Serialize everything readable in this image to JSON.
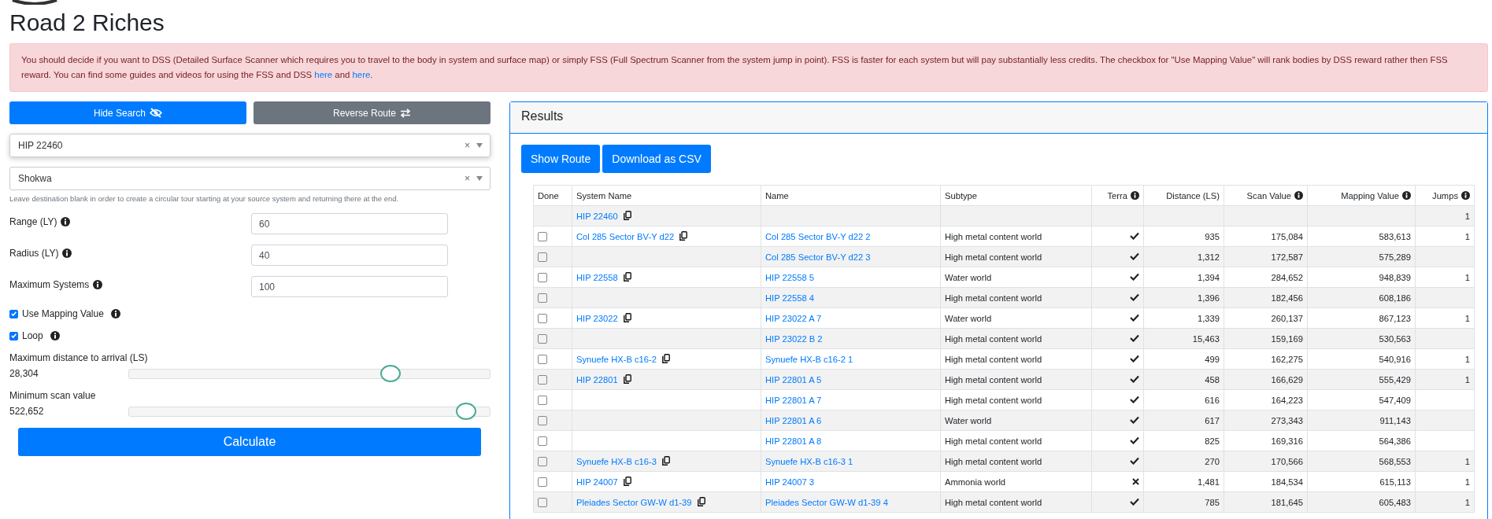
{
  "title": "Road 2 Riches",
  "alert": {
    "text": "You should decide if you want to DSS (Detailed Surface Scanner which requires you to travel to the body in system and surface map) or simply FSS (Full Spectrum Scanner from the system jump in point). FSS is faster for each system but will pay substantially less credits. The checkbox for \"Use Mapping Value\" will rank bodies by DSS reward rather then FSS reward. You can find some guides and videos for using the FSS and DSS",
    "link_1": "here",
    "joiner": "and",
    "link_2": "here",
    "end": "."
  },
  "search": {
    "buttons": [
      {
        "label": "Hide Search",
        "kind": "primary"
      },
      {
        "label": "Reverse Route",
        "kind": "secondary"
      }
    ],
    "source": {
      "value": "HIP 22460",
      "clear": "×"
    },
    "destination": {
      "value": "Shokwa",
      "clear": "×"
    },
    "hint": "Leave destination blank in order to create a circular tour starting at your source system and returning there at the end.",
    "fields": [
      {
        "label": "Range (LY)",
        "value": "60"
      },
      {
        "label": "Radius (LY)",
        "value": "40"
      },
      {
        "label": "Maximum Systems",
        "value": "100"
      }
    ],
    "checkboxes": [
      {
        "label": "Use Mapping Value",
        "checked": true
      },
      {
        "label": "Loop",
        "checked": true
      }
    ],
    "sliders": [
      {
        "label": "Maximum distance to arrival (LS)",
        "reading": "28,304",
        "level": 0.725
      },
      {
        "label": "Minimum scan value",
        "reading": "522,652",
        "level": 0.935
      }
    ],
    "calculate": "Calculate"
  },
  "results": {
    "title": "Results",
    "buttons": [
      "Show Route",
      "Download as CSV"
    ],
    "columns": [
      {
        "label": "Done",
        "info": false
      },
      {
        "label": "System Name",
        "info": false
      },
      {
        "label": "Name",
        "info": false
      },
      {
        "label": "Subtype",
        "info": false
      },
      {
        "label": "Terra",
        "info": true
      },
      {
        "label": "Distance (LS)",
        "info": false
      },
      {
        "label": "Scan Value",
        "info": true
      },
      {
        "label": "Mapping Value",
        "info": true
      },
      {
        "label": "Jumps",
        "info": true
      }
    ],
    "rows": [
      {
        "kind": "origin",
        "system": "HIP 22460",
        "jumps": "1"
      },
      {
        "kind": "body",
        "done": false,
        "system": "Col 285 Sector BV-Y d22",
        "name": "Col 285 Sector BV-Y d22 2",
        "subtype": "High metal content world",
        "terraformable": true,
        "distance": "935",
        "scan": "175,084",
        "mapping": "583,613",
        "jumps": "1"
      },
      {
        "kind": "body",
        "done": false,
        "name": "Col 285 Sector BV-Y d22 3",
        "subtype": "High metal content world",
        "terraformable": true,
        "distance": "1,312",
        "scan": "172,587",
        "mapping": "575,289"
      },
      {
        "kind": "body",
        "done": false,
        "system": "HIP 22558",
        "name": "HIP 22558 5",
        "subtype": "Water world",
        "terraformable": true,
        "distance": "1,394",
        "scan": "284,652",
        "mapping": "948,839",
        "jumps": "1"
      },
      {
        "kind": "body",
        "done": false,
        "name": "HIP 22558 4",
        "subtype": "High metal content world",
        "terraformable": true,
        "distance": "1,396",
        "scan": "182,456",
        "mapping": "608,186"
      },
      {
        "kind": "body",
        "done": false,
        "system": "HIP 23022",
        "name": "HIP 23022 A 7",
        "subtype": "Water world",
        "terraformable": true,
        "distance": "1,339",
        "scan": "260,137",
        "mapping": "867,123",
        "jumps": "1"
      },
      {
        "kind": "body",
        "done": false,
        "name": "HIP 23022 B 2",
        "subtype": "High metal content world",
        "terraformable": true,
        "distance": "15,463",
        "scan": "159,169",
        "mapping": "530,563"
      },
      {
        "kind": "body",
        "done": false,
        "system": "Synuefe HX-B c16-2",
        "name": "Synuefe HX-B c16-2 1",
        "subtype": "High metal content world",
        "terraformable": true,
        "distance": "499",
        "scan": "162,275",
        "mapping": "540,916",
        "jumps": "1"
      },
      {
        "kind": "body",
        "done": false,
        "system": "HIP 22801",
        "name": "HIP 22801 A 5",
        "subtype": "High metal content world",
        "terraformable": true,
        "distance": "458",
        "scan": "166,629",
        "mapping": "555,429",
        "jumps": "1"
      },
      {
        "kind": "body",
        "done": false,
        "name": "HIP 22801 A 7",
        "subtype": "High metal content world",
        "terraformable": true,
        "distance": "616",
        "scan": "164,223",
        "mapping": "547,409"
      },
      {
        "kind": "body",
        "done": false,
        "name": "HIP 22801 A 6",
        "subtype": "Water world",
        "terraformable": true,
        "distance": "617",
        "scan": "273,343",
        "mapping": "911,143"
      },
      {
        "kind": "body",
        "done": false,
        "name": "HIP 22801 A 8",
        "subtype": "High metal content world",
        "terraformable": true,
        "distance": "825",
        "scan": "169,316",
        "mapping": "564,386"
      },
      {
        "kind": "body",
        "done": false,
        "system": "Synuefe HX-B c16-3",
        "name": "Synuefe HX-B c16-3 1",
        "subtype": "High metal content world",
        "terraformable": true,
        "distance": "270",
        "scan": "170,566",
        "mapping": "568,553",
        "jumps": "1"
      },
      {
        "kind": "body",
        "done": false,
        "system": "HIP 24007",
        "name": "HIP 24007 3",
        "subtype": "Ammonia world",
        "terraformable": false,
        "distance": "1,481",
        "scan": "184,534",
        "mapping": "615,113",
        "jumps": "1"
      },
      {
        "kind": "body",
        "done": false,
        "system": "Pleiades Sector GW-W d1-39",
        "name": "Pleiades Sector GW-W d1-39 4",
        "subtype": "High metal content world",
        "terraformable": true,
        "distance": "785",
        "scan": "181,645",
        "mapping": "605,483",
        "jumps": "1"
      }
    ]
  }
}
